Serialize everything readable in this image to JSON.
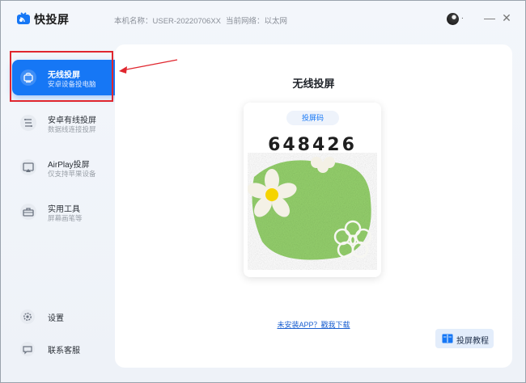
{
  "app": {
    "name": "快投屏",
    "host_label": "本机名称：USER-20220706XX",
    "network_label": "当前网络：以太网",
    "avatar_dot": ".",
    "minimize_glyph": "—",
    "close_glyph": "✕"
  },
  "sidebar": {
    "items": [
      {
        "title": "无线投屏",
        "subtitle": "安卓设备投电脑",
        "icon": "wireless-cast-icon",
        "active": true
      },
      {
        "title": "安卓有线投屏",
        "subtitle": "数据线连接投屏",
        "icon": "usb-cable-icon",
        "active": false
      },
      {
        "title": "AirPlay投屏",
        "subtitle": "仅支持苹果设备",
        "icon": "airplay-icon",
        "active": false
      },
      {
        "title": "实用工具",
        "subtitle": "屏幕画笔等",
        "icon": "toolbox-icon",
        "active": false
      }
    ],
    "bottom": [
      {
        "label": "设置",
        "icon": "gear-icon"
      },
      {
        "label": "联系客服",
        "icon": "chat-icon"
      }
    ]
  },
  "main": {
    "title": "无线投屏",
    "code_label": "投屏码",
    "code": "648426",
    "download_link": "未安装APP？戳我下载",
    "tutorial_button": "投屏教程"
  },
  "colors": {
    "accent": "#1677f5",
    "highlight_box": "#e0262e",
    "art_green": "#7fc95a"
  }
}
